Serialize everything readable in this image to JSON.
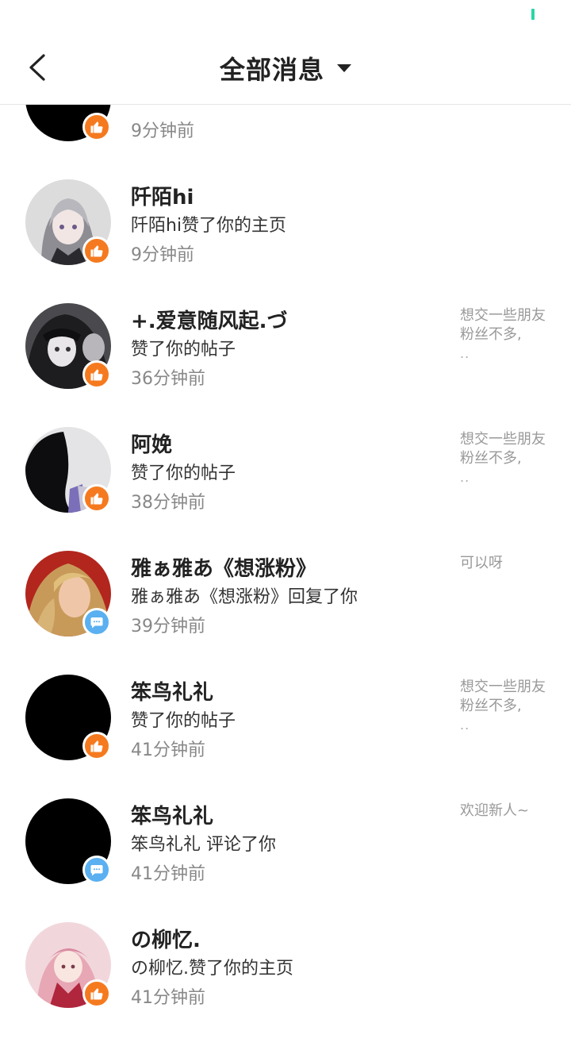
{
  "header": {
    "title": "全部消息"
  },
  "colors": {
    "like_badge": "#f57a1f",
    "comment_badge": "#5ab0f0",
    "accent": "#2ad6a6"
  },
  "icons": {
    "back": "chevron-left-icon",
    "dropdown": "caret-down-icon",
    "like": "thumbs-up-icon",
    "comment": "chat-bubble-icon"
  },
  "top_partial": {
    "time": "9分钟前",
    "preview_more": ".."
  },
  "messages": [
    {
      "name": "阡陌hi",
      "action": "阡陌hi赞了你的主页",
      "time": "9分钟前",
      "preview": "",
      "preview_more": "",
      "type": "like"
    },
    {
      "name": "+.爱意随风起.づ",
      "action": "赞了你的帖子",
      "time": "36分钟前",
      "preview": "想交一些朋友粉丝不多,",
      "preview_more": "..",
      "type": "like"
    },
    {
      "name": "阿娩",
      "action": "赞了你的帖子",
      "time": "38分钟前",
      "preview": "想交一些朋友粉丝不多,",
      "preview_more": "..",
      "type": "like"
    },
    {
      "name": "雅ぁ雅あ《想涨粉》",
      "action": "雅ぁ雅あ《想涨粉》回复了你",
      "time": "39分钟前",
      "preview": "可以呀",
      "preview_more": "",
      "type": "comment"
    },
    {
      "name": "笨鸟礼礼",
      "action": "赞了你的帖子",
      "time": "41分钟前",
      "preview": "想交一些朋友粉丝不多,",
      "preview_more": "..",
      "type": "like"
    },
    {
      "name": "笨鸟礼礼",
      "action": "笨鸟礼礼 评论了你",
      "time": "41分钟前",
      "preview": "欢迎新人~",
      "preview_more": "",
      "type": "comment"
    },
    {
      "name": "の柳忆.",
      "action": "の柳忆.赞了你的主页",
      "time": "41分钟前",
      "preview": "",
      "preview_more": "",
      "type": "like"
    }
  ]
}
